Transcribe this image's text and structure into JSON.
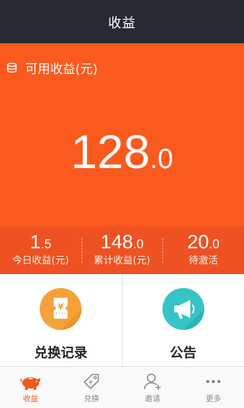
{
  "header": {
    "title": "收益"
  },
  "hero": {
    "label": "可用收益(元)",
    "amount_int": "128",
    "amount_dec": ".0"
  },
  "stats": [
    {
      "int": "1",
      "dec": ".5",
      "label": "今日收益(元)"
    },
    {
      "int": "148",
      "dec": ".0",
      "label": "累计收益(元)"
    },
    {
      "int": "20",
      "dec": ".0",
      "label": "待激活"
    }
  ],
  "cards": [
    {
      "label": "兑换记录",
      "icon": "ticket-yuan-icon"
    },
    {
      "label": "公告",
      "icon": "megaphone-icon"
    }
  ],
  "tabs": [
    {
      "label": "收益",
      "icon": "piggy-bank-icon",
      "active": true
    },
    {
      "label": "兑换",
      "icon": "tag-icon",
      "active": false
    },
    {
      "label": "邀请",
      "icon": "add-user-icon",
      "active": false
    },
    {
      "label": "更多",
      "icon": "more-icon",
      "active": false
    }
  ],
  "colors": {
    "header_bg": "#262a33",
    "hero_bg": "#fb5a1f",
    "stats_bg": "#ee5222",
    "accent": "#ef5a1e",
    "card_orange": "#f5a13a",
    "card_teal": "#36c4c6"
  }
}
